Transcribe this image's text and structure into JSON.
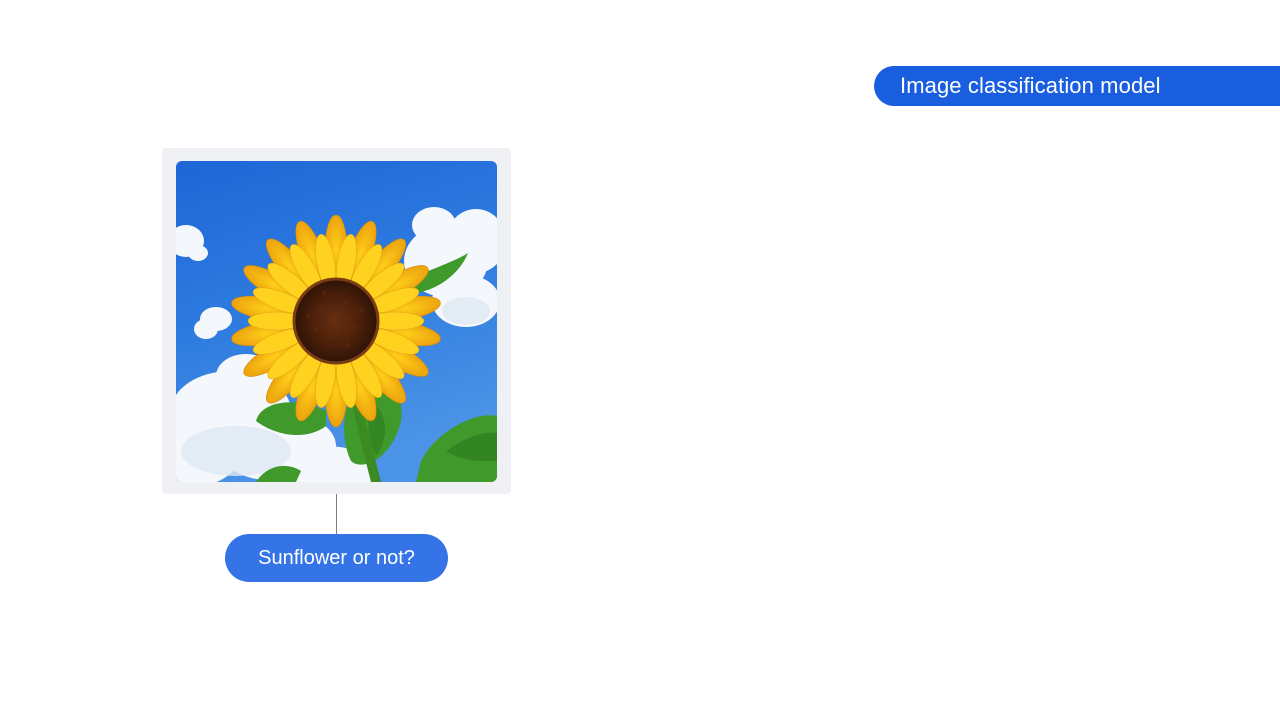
{
  "header": {
    "title": "Image classification model"
  },
  "image": {
    "subject_icon": "sunflower-photo"
  },
  "question": {
    "label": "Sunflower or not?"
  },
  "colors": {
    "title_pill": "#1a5ee0",
    "question_pill": "#3474e6",
    "frame": "#eef0f3",
    "connector": "#7a7f87"
  }
}
